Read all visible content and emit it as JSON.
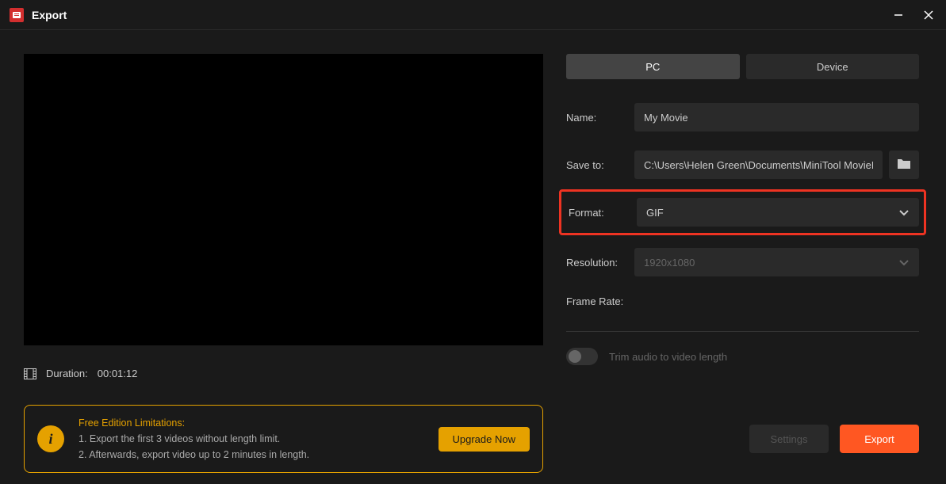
{
  "window": {
    "title": "Export"
  },
  "preview": {
    "duration_label": "Duration:",
    "duration_value": "00:01:12"
  },
  "tabs": {
    "pc": "PC",
    "device": "Device"
  },
  "form": {
    "name_label": "Name:",
    "name_value": "My Movie",
    "saveto_label": "Save to:",
    "saveto_value": "C:\\Users\\Helen Green\\Documents\\MiniTool MovieM",
    "format_label": "Format:",
    "format_value": "GIF",
    "resolution_label": "Resolution:",
    "resolution_value": "1920x1080",
    "framerate_label": "Frame Rate:",
    "trim_label": "Trim audio to video length"
  },
  "limitations": {
    "title": "Free Edition Limitations:",
    "line1": "1. Export the first 3 videos without length limit.",
    "line2": "2. Afterwards, export video up to 2 minutes in length.",
    "upgrade": "Upgrade Now"
  },
  "actions": {
    "settings": "Settings",
    "export": "Export"
  }
}
